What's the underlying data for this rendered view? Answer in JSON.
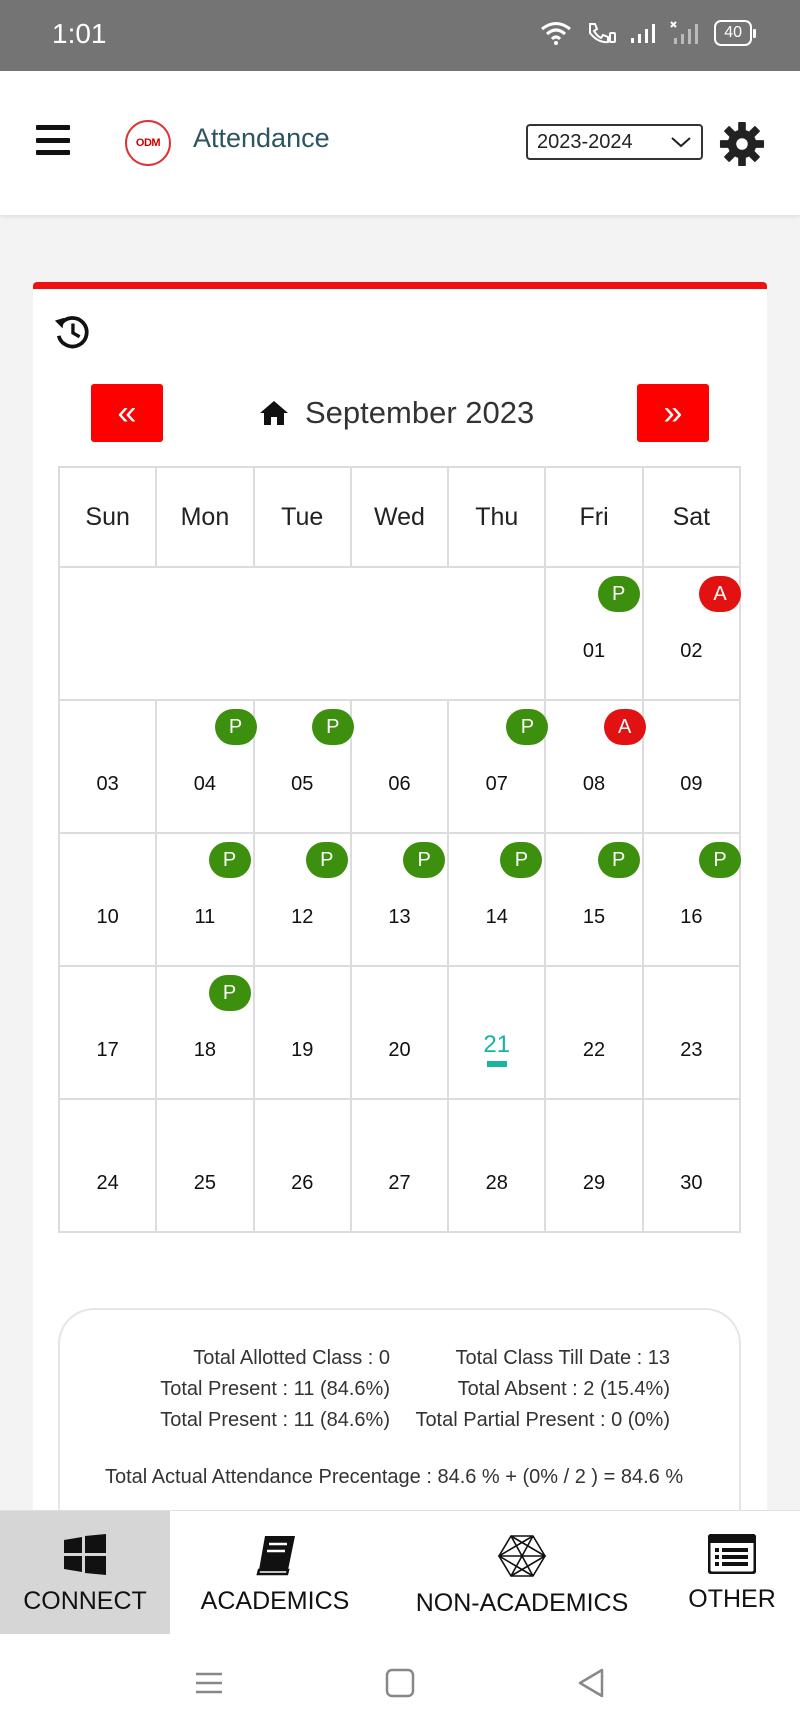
{
  "status_bar": {
    "time": "1:01",
    "battery": "40"
  },
  "header": {
    "menu_icon": "hamburger-menu-icon",
    "title": "Attendance",
    "logo_text": "ODM",
    "session": "2023-2024"
  },
  "calendar": {
    "month_title": "September 2023",
    "prev_label": "«",
    "next_label": "»",
    "weekdays": [
      "Sun",
      "Mon",
      "Tue",
      "Wed",
      "Thu",
      "Fri",
      "Sat"
    ],
    "today": "21",
    "weeks": [
      [
        {
          "d": ""
        },
        {
          "d": ""
        },
        {
          "d": ""
        },
        {
          "d": ""
        },
        {
          "d": ""
        },
        {
          "d": "01",
          "s": "P"
        },
        {
          "d": "02",
          "s": "A"
        }
      ],
      [
        {
          "d": "03"
        },
        {
          "d": "04",
          "s": "P"
        },
        {
          "d": "05",
          "s": "P"
        },
        {
          "d": "06"
        },
        {
          "d": "07",
          "s": "P"
        },
        {
          "d": "08",
          "s": "A"
        },
        {
          "d": "09"
        }
      ],
      [
        {
          "d": "10"
        },
        {
          "d": "11",
          "s": "P"
        },
        {
          "d": "12",
          "s": "P"
        },
        {
          "d": "13",
          "s": "P"
        },
        {
          "d": "14",
          "s": "P"
        },
        {
          "d": "15",
          "s": "P"
        },
        {
          "d": "16",
          "s": "P"
        }
      ],
      [
        {
          "d": "17"
        },
        {
          "d": "18",
          "s": "P"
        },
        {
          "d": "19"
        },
        {
          "d": "20"
        },
        {
          "d": "21"
        },
        {
          "d": "22"
        },
        {
          "d": "23"
        }
      ],
      [
        {
          "d": "24"
        },
        {
          "d": "25"
        },
        {
          "d": "26"
        },
        {
          "d": "27"
        },
        {
          "d": "28"
        },
        {
          "d": "29"
        },
        {
          "d": "30"
        }
      ]
    ]
  },
  "summary": {
    "allotted": "Total Allotted Class : 0",
    "till_date": "Total Class Till Date : 13",
    "present_1": "Total Present : 11 (84.6%)",
    "absent": "Total Absent : 2 (15.4%)",
    "present_2": "Total Present : 11 (84.6%)",
    "partial": "Total Partial Present : 0 (0%)",
    "actual": "Total Actual Attendance Precentage : 84.6 % + (0% / 2 ) = 84.6 %"
  },
  "tabs": {
    "connect": "CONNECT",
    "academics": "ACADEMICS",
    "non_academics": "NON-ACADEMICS",
    "other": "OTHER"
  },
  "colors": {
    "present": "#3d8f0e",
    "absent": "#e31212",
    "accent": "#ff0000",
    "today": "#19b3a0"
  }
}
